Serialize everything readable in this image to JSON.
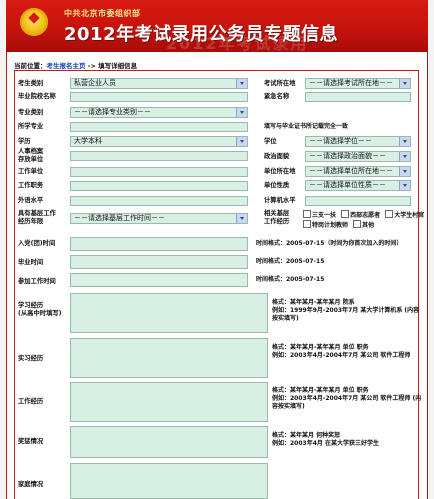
{
  "header": {
    "org": "中共北京市委组织部",
    "title": "2012年考试录用公务员专题信息",
    "watermark": "2012年考试录用"
  },
  "breadcrumb": {
    "prefix": "当前位置：",
    "link": "考生报名主页",
    "sep": " -> ",
    "current": "填写详细信息"
  },
  "form": {
    "kaosheng_leibie": {
      "label": "考生类别",
      "value": "私营企业人员"
    },
    "kaoshi_suozaidi": {
      "label": "考试所在地",
      "value": "－－请选择考试所在地－－"
    },
    "biye_yuanxiao": {
      "label": "毕业院校名称"
    },
    "jiating_mingcheng": {
      "label": "紧急名称"
    },
    "zhuanye_leibie": {
      "label": "专业类别",
      "value": "－－请选择专业类别－－"
    },
    "zhuanye_mingcheng": {
      "label": "所学专业"
    },
    "zhuanye_note": "填写与毕业证书所记载完全一致",
    "xueli": {
      "label": "学历",
      "value": "大学本科"
    },
    "xuewei": {
      "label": "学位",
      "value": "－－请选择学位－－"
    },
    "renshi_dangan": {
      "label": "人事档案\n存放单位"
    },
    "zhengzhi_mianmao": {
      "label": "政治面貌",
      "value": "－－请选择政治面貌－－"
    },
    "gongzuo_danwei": {
      "label": "工作单位"
    },
    "danwei_suozaidi": {
      "label": "单位所在地",
      "value": "－－请选择单位所在地－－"
    },
    "gongzuo_zhiwu": {
      "label": "工作职务"
    },
    "danwei_xingzhi": {
      "label": "单位性质",
      "value": "－－请选择单位性质－－"
    },
    "waiyu": {
      "label": "外语水平"
    },
    "jisuanji": {
      "label": "计算机水平"
    },
    "jiceng_nianxian": {
      "label": "具有基层工作\n经历年限",
      "value": "－－请选择基层工作时间－－"
    },
    "jiceng_jingli": {
      "label": "相关基层\n工作经历"
    },
    "jiceng_options": [
      "三支一扶",
      "西部志愿者",
      "大学生村官",
      "特岗计划教师",
      "其他"
    ],
    "rudang_shijian": {
      "label": "入党(团)时间",
      "note": "时间格式：2005-07-15（时间为你首次加入的时间）"
    },
    "biye_shijian": {
      "label": "毕业时间",
      "note": "时间格式：2005-07-15"
    },
    "canjia_gongzuo": {
      "label": "参加工作时间",
      "note": "时间格式：2005-07-15"
    },
    "xuexi_jingli": {
      "label": "学习经历\n(从高中时填写)",
      "note": "格式：某年某月-某年某月 院系\n例如：1999年9月-2003年7月 某大学计算机系 (内容按实填写)"
    },
    "shixi_jingli": {
      "label": "实习经历",
      "note": "格式：某年某月-某年某月 单位 职务\n例如：2003年4月-2004年7月 某公司 软件工程师"
    },
    "gongzuo_jingli": {
      "label": "工作经历",
      "note": "格式：某年某月-某年某月 单位 职务\n例如：2003年4月-2004年7月 某公司 软件工程师 (内容按实填写)"
    },
    "jiangcheng": {
      "label": "奖惩情况",
      "note": "格式：某年某月 何种奖惩\n例如：2003年4月 在某大学获三好学生"
    },
    "jiating": {
      "label": "家庭情况"
    }
  }
}
